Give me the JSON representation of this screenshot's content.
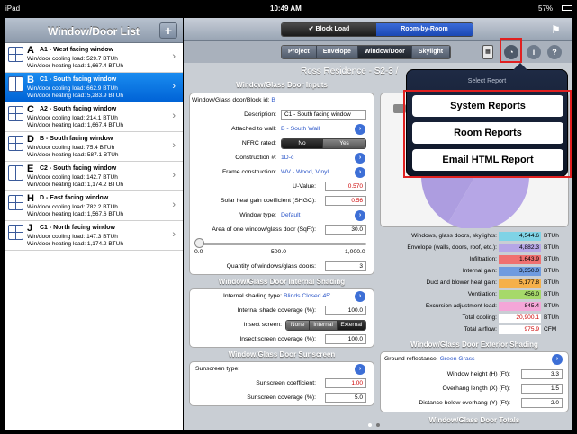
{
  "status": {
    "device": "iPad",
    "time": "10:49 AM",
    "battery": "57%"
  },
  "left": {
    "title": "Window/Door List",
    "add_label": "+",
    "items": [
      {
        "letter": "A",
        "name": "A1 - West facing window",
        "cooling": "Win/door cooling load: 529.7 BTUh",
        "heating": "Win/door heating load: 1,667.4 BTUh"
      },
      {
        "letter": "B",
        "name": "C1 - South facing window",
        "cooling": "Win/door cooling load: 662.9 BTUh",
        "heating": "Win/door heating load: 5,283.9 BTUh"
      },
      {
        "letter": "C",
        "name": "A2 - South facing window",
        "cooling": "Win/door cooling load: 214.1 BTUh",
        "heating": "Win/door heating load: 1,667.4 BTUh"
      },
      {
        "letter": "D",
        "name": "B - South facing window",
        "cooling": "Win/door cooling load: 75.4 BTUh",
        "heating": "Win/door heating load: 587.1 BTUh"
      },
      {
        "letter": "E",
        "name": "C2 - South facing window",
        "cooling": "Win/door cooling load: 142.7 BTUh",
        "heating": "Win/door heating load: 1,174.2 BTUh"
      },
      {
        "letter": "H",
        "name": "D - East facing window",
        "cooling": "Win/door cooling load: 782.2 BTUh",
        "heating": "Win/door heating load: 1,567.6 BTUh"
      },
      {
        "letter": "J",
        "name": "C1 - North facing window",
        "cooling": "Win/door cooling load: 147.3 BTUh",
        "heating": "Win/door heating load: 1,174.2 BTUh"
      }
    ]
  },
  "top": {
    "block_load": "Block Load",
    "room_by_room": "Room-by-Room"
  },
  "tabs": [
    "Project",
    "Envelope",
    "Window/Door",
    "Skylight"
  ],
  "page_title": "Ross Residence - S2-3 /",
  "inputs": {
    "header": "Window/Glass Door Inputs",
    "id_label": "Window/Glass door/Block id:",
    "id_value": "B",
    "desc_label": "Description:",
    "desc_value": "C1 - South facing window",
    "wall_label": "Attached to wall:",
    "wall_value": "B - South Wall",
    "nfrc_label": "NFRC rated:",
    "nfrc_no": "No",
    "nfrc_yes": "Yes",
    "construction_label": "Construction #:",
    "construction_value": "1D-c",
    "frame_label": "Frame construction:",
    "frame_value": "WV - Wood, Vinyl",
    "uvalue_label": "U-Value:",
    "uvalue_value": "0.570",
    "shgc_label": "Solar heat gain coefficient (SHGC):",
    "shgc_value": "0.56",
    "type_label": "Window type:",
    "type_value": "Default",
    "area_label": "Area of one window/glass door (SqFt):",
    "area_value": "30.0",
    "slider_min": "0.0",
    "slider_mid": "500.0",
    "slider_max": "1,000.0",
    "qty_label": "Quantity of windows/glass doors:",
    "qty_value": "3"
  },
  "shading": {
    "header": "Window/Glass Door Internal Shading",
    "type_label": "Internal shading type:",
    "type_value": "Blinds Closed 45'...",
    "coverage_label": "Internal shade coverage (%):",
    "coverage_value": "100.0",
    "insect_label": "Insect screen:",
    "insect_none": "None",
    "insect_internal": "Internal",
    "insect_external": "External",
    "insect_cov_label": "Insect screen coverage (%):",
    "insect_cov_value": "100.0"
  },
  "sunscreen": {
    "header": "Window/Glass Door Sunscreen",
    "type_label": "Sunscreen type:",
    "coef_label": "Sunscreen coefficient:",
    "coef_value": "1.00",
    "cov_label": "Sunscreen coverage (%):",
    "cov_value": "5.0"
  },
  "loads": [
    {
      "label": "Windows, glass doors, skylights:",
      "value": "4,544.6",
      "unit": "BTUh",
      "color": "#7fd3e6"
    },
    {
      "label": "Envelope (walls, doors, roof, etc.):",
      "value": "4,882.3",
      "unit": "BTUh",
      "color": "#b6a6e6"
    },
    {
      "label": "Infiltration:",
      "value": "1,643.9",
      "unit": "BTUh",
      "color": "#f07070"
    },
    {
      "label": "Internal gain:",
      "value": "3,350.0",
      "unit": "BTUh",
      "color": "#6f9be0"
    },
    {
      "label": "Duct and blower heat gain:",
      "value": "5,177.8",
      "unit": "BTUh",
      "color": "#f5b04a"
    },
    {
      "label": "Ventilation:",
      "value": "456.0",
      "unit": "BTUh",
      "color": "#a6d96a"
    },
    {
      "label": "Excursion adjustment load:",
      "value": "845.4",
      "unit": "BTUh",
      "color": "#f4a6d8"
    },
    {
      "label": "Total cooling:",
      "value": "20,900.1",
      "unit": "BTUh",
      "color": "#ffffff"
    },
    {
      "label": "Total airflow:",
      "value": "975.9",
      "unit": "CFM",
      "color": "#ffffff"
    }
  ],
  "exterior": {
    "header": "Window/Glass Door Exterior Shading",
    "ground_label": "Ground reflectance:",
    "ground_value": "Green Grass",
    "height_label": "Window height (H) (Ft):",
    "height_value": "3.3",
    "overhang_label": "Overhang length (X) (Ft):",
    "overhang_value": "1.5",
    "distance_label": "Distance below overhang (Y) (Ft):",
    "distance_value": "2.0"
  },
  "totals_header": "Window/Glass Door Totals",
  "popover": {
    "title": "Select Report",
    "system": "System Reports",
    "room": "Room Reports",
    "email": "Email HTML Report"
  }
}
